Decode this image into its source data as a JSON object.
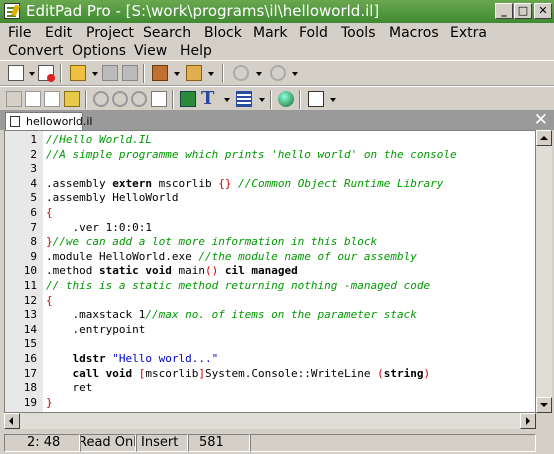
{
  "window": {
    "title": "EditPad Pro - [S:\\work\\programs\\il\\helloworld.il]",
    "minimize": "_",
    "maximize": "□",
    "close": "✕"
  },
  "menu": [
    "File",
    "Edit",
    "Project",
    "Search",
    "Block",
    "Mark",
    "Fold",
    "Tools",
    "Macros",
    "Extra",
    "Convert",
    "Options",
    "View",
    "Help"
  ],
  "tab": {
    "label": "helloworld.il",
    "close": "✕"
  },
  "lines": [
    {
      "n": "1",
      "segs": [
        {
          "t": "//Hello World.IL",
          "c": "cm"
        }
      ]
    },
    {
      "n": "2",
      "segs": [
        {
          "t": "//A simple programme which prints 'hello world' on the console",
          "c": "cm"
        }
      ]
    },
    {
      "n": "3",
      "segs": []
    },
    {
      "n": "4",
      "segs": [
        {
          "t": ".assembly ",
          "c": ""
        },
        {
          "t": "extern",
          "c": "kw"
        },
        {
          "t": " mscorlib ",
          "c": ""
        },
        {
          "t": "{}",
          "c": "br"
        },
        {
          "t": " //Common Object Runtime Library",
          "c": "cm"
        }
      ]
    },
    {
      "n": "5",
      "segs": [
        {
          "t": ".assembly HelloWorld",
          "c": ""
        }
      ]
    },
    {
      "n": "6",
      "segs": [
        {
          "t": "{",
          "c": "br"
        }
      ]
    },
    {
      "n": "7",
      "segs": [
        {
          "t": "    .ver 1:0:0:1",
          "c": ""
        }
      ]
    },
    {
      "n": "8",
      "segs": [
        {
          "t": "}",
          "c": "br"
        },
        {
          "t": "//we can add a lot more information in this block",
          "c": "cm"
        }
      ]
    },
    {
      "n": "9",
      "segs": [
        {
          "t": ".module HelloWorld.exe ",
          "c": ""
        },
        {
          "t": "//the module name of our assembly",
          "c": "cm"
        }
      ]
    },
    {
      "n": "10",
      "segs": [
        {
          "t": ".method ",
          "c": ""
        },
        {
          "t": "static void",
          "c": "kw"
        },
        {
          "t": " main",
          "c": ""
        },
        {
          "t": "()",
          "c": "br"
        },
        {
          "t": " ",
          "c": ""
        },
        {
          "t": "cil managed",
          "c": "kw"
        }
      ]
    },
    {
      "n": "11",
      "segs": [
        {
          "t": "// this is a static method returning nothing -managed code",
          "c": "cm"
        }
      ]
    },
    {
      "n": "12",
      "segs": [
        {
          "t": "{",
          "c": "br"
        }
      ]
    },
    {
      "n": "13",
      "segs": [
        {
          "t": "    .maxstack 1",
          "c": ""
        },
        {
          "t": "//max no. of items on the parameter stack",
          "c": "cm"
        }
      ]
    },
    {
      "n": "14",
      "segs": [
        {
          "t": "    .entrypoint",
          "c": ""
        }
      ]
    },
    {
      "n": "15",
      "segs": []
    },
    {
      "n": "16",
      "segs": [
        {
          "t": "    ",
          "c": ""
        },
        {
          "t": "ldstr",
          "c": "kw"
        },
        {
          "t": " ",
          "c": ""
        },
        {
          "t": "\"Hello world...\"",
          "c": "str"
        }
      ]
    },
    {
      "n": "17",
      "segs": [
        {
          "t": "    ",
          "c": ""
        },
        {
          "t": "call void",
          "c": "kw"
        },
        {
          "t": " ",
          "c": ""
        },
        {
          "t": "[",
          "c": "br"
        },
        {
          "t": "mscorlib",
          "c": ""
        },
        {
          "t": "]",
          "c": "br"
        },
        {
          "t": "System.Console::WriteLine ",
          "c": ""
        },
        {
          "t": "(",
          "c": "br"
        },
        {
          "t": "string",
          "c": "kw"
        },
        {
          "t": ")",
          "c": "br"
        }
      ]
    },
    {
      "n": "18",
      "segs": [
        {
          "t": "    ret",
          "c": ""
        }
      ]
    },
    {
      "n": "19",
      "segs": [
        {
          "t": "}",
          "c": "br"
        }
      ]
    }
  ],
  "status": {
    "position": "2: 48",
    "mode": "Read Only",
    "insert": "Insert",
    "size": "581"
  },
  "colors": {
    "title_green": "#4c9a3c",
    "comment": "#009900",
    "bracket": "#cc0000",
    "string": "#0000cc",
    "tabbar": "#9a9a9a"
  }
}
